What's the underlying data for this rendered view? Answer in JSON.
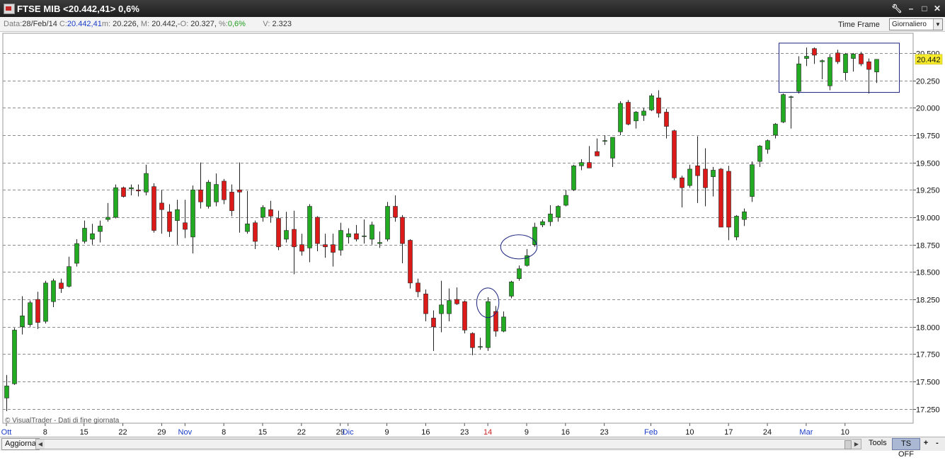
{
  "window": {
    "title": "FTSE MIB <20.442,41> 0,6%",
    "buttons": [
      "wrench-icon",
      "minimize-icon",
      "maximize-icon",
      "close-icon"
    ]
  },
  "info_bar": {
    "data_label": "Data:",
    "data_value": "28/Feb/14",
    "c_label": "C:",
    "c_value": "20.442,41",
    "m_label": "m:",
    "m_value": "20.226,",
    "M_label": "M:",
    "M_value": "20.442,",
    "o_label": "O:",
    "o_value": "20.327,",
    "pct_label": "%:",
    "pct_value": "0,6%",
    "v_label": "V:",
    "v_value": "2.323",
    "timeframe_label": "Time Frame",
    "timeframe_value": "Giornaliero"
  },
  "bottom_bar": {
    "refresh_label": "Aggiorna",
    "tools_label": "Tools",
    "tsoff_label": "TS OFF",
    "zoom_in_label": "+",
    "zoom_out_label": "-"
  },
  "chart_data": {
    "type": "candlestick",
    "watermark": "© VisualTrader - Dati di fine giornata",
    "last_price_label": "20.442",
    "y_axis": {
      "min": 17120,
      "max": 20680,
      "ticks": [
        17250,
        17500,
        17750,
        18000,
        18250,
        18500,
        18750,
        19000,
        19250,
        19500,
        19750,
        20000,
        20250,
        20500
      ],
      "tick_labels": [
        "17.250",
        "17.500",
        "17.750",
        "18.000",
        "18.250",
        "18.500",
        "18.750",
        "19.000",
        "19.250",
        "19.500",
        "19.750",
        "20.000",
        "20.250",
        "20.500"
      ],
      "grid": "dashed"
    },
    "x_axis_labels": [
      {
        "i": 0,
        "text": "Ott",
        "color": "#1a3cc8"
      },
      {
        "i": 5,
        "text": "8",
        "color": "#111111"
      },
      {
        "i": 10,
        "text": "15",
        "color": "#111111"
      },
      {
        "i": 15,
        "text": "22",
        "color": "#111111"
      },
      {
        "i": 20,
        "text": "29",
        "color": "#111111"
      },
      {
        "i": 23,
        "text": "Nov",
        "color": "#1a3cc8"
      },
      {
        "i": 28,
        "text": "8",
        "color": "#111111"
      },
      {
        "i": 33,
        "text": "15",
        "color": "#111111"
      },
      {
        "i": 38,
        "text": "22",
        "color": "#111111"
      },
      {
        "i": 43,
        "text": "29",
        "color": "#111111"
      },
      {
        "i": 44,
        "text": "Dic",
        "color": "#1a3cc8"
      },
      {
        "i": 49,
        "text": "9",
        "color": "#111111"
      },
      {
        "i": 54,
        "text": "16",
        "color": "#111111"
      },
      {
        "i": 59,
        "text": "23",
        "color": "#111111"
      },
      {
        "i": 62,
        "text": "14",
        "color": "#cc2222"
      },
      {
        "i": 67,
        "text": "9",
        "color": "#111111"
      },
      {
        "i": 72,
        "text": "16",
        "color": "#111111"
      },
      {
        "i": 77,
        "text": "23",
        "color": "#111111"
      },
      {
        "i": 83,
        "text": "Feb",
        "color": "#1a3cc8"
      },
      {
        "i": 88,
        "text": "10",
        "color": "#111111"
      },
      {
        "i": 93,
        "text": "17",
        "color": "#111111"
      },
      {
        "i": 98,
        "text": "24",
        "color": "#111111"
      },
      {
        "i": 103,
        "text": "Mar",
        "color": "#1a3cc8"
      },
      {
        "i": 108,
        "text": "10",
        "color": "#111111"
      }
    ],
    "candles": [
      {
        "o": 17350,
        "h": 17560,
        "l": 17230,
        "c": 17460
      },
      {
        "o": 17480,
        "h": 17990,
        "l": 17470,
        "c": 17970
      },
      {
        "o": 18000,
        "h": 18280,
        "l": 17930,
        "c": 18100
      },
      {
        "o": 18020,
        "h": 18240,
        "l": 18000,
        "c": 18220
      },
      {
        "o": 18250,
        "h": 18320,
        "l": 17980,
        "c": 18040
      },
      {
        "o": 18050,
        "h": 18420,
        "l": 18030,
        "c": 18400
      },
      {
        "o": 18230,
        "h": 18440,
        "l": 18180,
        "c": 18420
      },
      {
        "o": 18400,
        "h": 18440,
        "l": 18310,
        "c": 18350
      },
      {
        "o": 18370,
        "h": 18640,
        "l": 18360,
        "c": 18550
      },
      {
        "o": 18580,
        "h": 18800,
        "l": 18550,
        "c": 18760
      },
      {
        "o": 18780,
        "h": 18970,
        "l": 18760,
        "c": 18900
      },
      {
        "o": 18800,
        "h": 18940,
        "l": 18750,
        "c": 18850
      },
      {
        "o": 18870,
        "h": 18970,
        "l": 18770,
        "c": 18920
      },
      {
        "o": 18980,
        "h": 19130,
        "l": 18960,
        "c": 19000
      },
      {
        "o": 19000,
        "h": 19300,
        "l": 18990,
        "c": 19270
      },
      {
        "o": 19270,
        "h": 19280,
        "l": 19180,
        "c": 19190
      },
      {
        "o": 19260,
        "h": 19300,
        "l": 19200,
        "c": 19270
      },
      {
        "o": 19250,
        "h": 19300,
        "l": 19190,
        "c": 19240
      },
      {
        "o": 19230,
        "h": 19480,
        "l": 19200,
        "c": 19400
      },
      {
        "o": 19280,
        "h": 19310,
        "l": 18860,
        "c": 18880
      },
      {
        "o": 19130,
        "h": 19250,
        "l": 18850,
        "c": 19070
      },
      {
        "o": 19050,
        "h": 19120,
        "l": 18820,
        "c": 18870
      },
      {
        "o": 18970,
        "h": 19160,
        "l": 18750,
        "c": 19070
      },
      {
        "o": 18950,
        "h": 19160,
        "l": 18810,
        "c": 18890
      },
      {
        "o": 18820,
        "h": 19290,
        "l": 18670,
        "c": 19250
      },
      {
        "o": 19250,
        "h": 19500,
        "l": 19080,
        "c": 19140
      },
      {
        "o": 19100,
        "h": 19340,
        "l": 19080,
        "c": 19320
      },
      {
        "o": 19140,
        "h": 19400,
        "l": 19100,
        "c": 19300
      },
      {
        "o": 19330,
        "h": 19350,
        "l": 19120,
        "c": 19160
      },
      {
        "o": 19230,
        "h": 19300,
        "l": 19010,
        "c": 19060
      },
      {
        "o": 19250,
        "h": 19500,
        "l": 18860,
        "c": 19230
      },
      {
        "o": 18870,
        "h": 19240,
        "l": 18850,
        "c": 18940
      },
      {
        "o": 18950,
        "h": 18970,
        "l": 18710,
        "c": 18780
      },
      {
        "o": 19000,
        "h": 19110,
        "l": 18960,
        "c": 19090
      },
      {
        "o": 19070,
        "h": 19150,
        "l": 18950,
        "c": 19010
      },
      {
        "o": 18990,
        "h": 19060,
        "l": 18700,
        "c": 18730
      },
      {
        "o": 18800,
        "h": 19050,
        "l": 18770,
        "c": 18880
      },
      {
        "o": 18890,
        "h": 19060,
        "l": 18480,
        "c": 18730
      },
      {
        "o": 18750,
        "h": 18850,
        "l": 18650,
        "c": 18690
      },
      {
        "o": 18720,
        "h": 19120,
        "l": 18590,
        "c": 19100
      },
      {
        "o": 19000,
        "h": 19010,
        "l": 18690,
        "c": 18760
      },
      {
        "o": 18750,
        "h": 18850,
        "l": 18630,
        "c": 18730
      },
      {
        "o": 18750,
        "h": 18850,
        "l": 18550,
        "c": 18680
      },
      {
        "o": 18700,
        "h": 18950,
        "l": 18650,
        "c": 18880
      },
      {
        "o": 18820,
        "h": 18900,
        "l": 18760,
        "c": 18850
      },
      {
        "o": 18850,
        "h": 18930,
        "l": 18780,
        "c": 18800
      },
      {
        "o": 18830,
        "h": 18980,
        "l": 18760,
        "c": 18830
      },
      {
        "o": 18800,
        "h": 18960,
        "l": 18750,
        "c": 18930
      },
      {
        "o": 18760,
        "h": 18870,
        "l": 18720,
        "c": 18770
      },
      {
        "o": 18800,
        "h": 19140,
        "l": 18780,
        "c": 19100
      },
      {
        "o": 19100,
        "h": 19200,
        "l": 18960,
        "c": 19000
      },
      {
        "o": 19000,
        "h": 19020,
        "l": 18580,
        "c": 18760
      },
      {
        "o": 18790,
        "h": 18800,
        "l": 18350,
        "c": 18400
      },
      {
        "o": 18400,
        "h": 18440,
        "l": 18270,
        "c": 18320
      },
      {
        "o": 18300,
        "h": 18340,
        "l": 18050,
        "c": 18120
      },
      {
        "o": 18080,
        "h": 18150,
        "l": 17780,
        "c": 18000
      },
      {
        "o": 18120,
        "h": 18420,
        "l": 17950,
        "c": 18200
      },
      {
        "o": 18120,
        "h": 18350,
        "l": 18050,
        "c": 18240
      },
      {
        "o": 18250,
        "h": 18360,
        "l": 18200,
        "c": 18210
      },
      {
        "o": 18230,
        "h": 18240,
        "l": 17940,
        "c": 17970
      },
      {
        "o": 17940,
        "h": 17950,
        "l": 17740,
        "c": 17810
      },
      {
        "o": 17820,
        "h": 17900,
        "l": 17790,
        "c": 17820
      },
      {
        "o": 17810,
        "h": 18270,
        "l": 17780,
        "c": 18230
      },
      {
        "o": 18140,
        "h": 18190,
        "l": 17910,
        "c": 17960
      },
      {
        "o": 17960,
        "h": 18140,
        "l": 17950,
        "c": 18090
      },
      {
        "o": 18280,
        "h": 18420,
        "l": 18260,
        "c": 18410
      },
      {
        "o": 18440,
        "h": 18560,
        "l": 18420,
        "c": 18530
      },
      {
        "o": 18560,
        "h": 18710,
        "l": 18550,
        "c": 18650
      },
      {
        "o": 18750,
        "h": 18950,
        "l": 18730,
        "c": 18910
      },
      {
        "o": 18930,
        "h": 18980,
        "l": 18910,
        "c": 18960
      },
      {
        "o": 18960,
        "h": 19110,
        "l": 18920,
        "c": 19030
      },
      {
        "o": 19000,
        "h": 19110,
        "l": 18960,
        "c": 19100
      },
      {
        "o": 19110,
        "h": 19250,
        "l": 19100,
        "c": 19200
      },
      {
        "o": 19250,
        "h": 19480,
        "l": 19240,
        "c": 19470
      },
      {
        "o": 19470,
        "h": 19530,
        "l": 19430,
        "c": 19500
      },
      {
        "o": 19500,
        "h": 19650,
        "l": 19460,
        "c": 19450
      },
      {
        "o": 19600,
        "h": 19720,
        "l": 19560,
        "c": 19560
      },
      {
        "o": 19700,
        "h": 19750,
        "l": 19660,
        "c": 19700
      },
      {
        "o": 19540,
        "h": 19730,
        "l": 19460,
        "c": 19730
      },
      {
        "o": 19780,
        "h": 20060,
        "l": 19750,
        "c": 20040
      },
      {
        "o": 20050,
        "h": 20070,
        "l": 19840,
        "c": 19850
      },
      {
        "o": 19880,
        "h": 19970,
        "l": 19810,
        "c": 19960
      },
      {
        "o": 19930,
        "h": 20000,
        "l": 19880,
        "c": 19970
      },
      {
        "o": 19980,
        "h": 20130,
        "l": 19970,
        "c": 20110
      },
      {
        "o": 20090,
        "h": 20160,
        "l": 19910,
        "c": 19950
      },
      {
        "o": 19960,
        "h": 19990,
        "l": 19720,
        "c": 19830
      },
      {
        "o": 19790,
        "h": 19800,
        "l": 19340,
        "c": 19360
      },
      {
        "o": 19360,
        "h": 19380,
        "l": 19090,
        "c": 19270
      },
      {
        "o": 19290,
        "h": 19480,
        "l": 19270,
        "c": 19440
      },
      {
        "o": 19470,
        "h": 19740,
        "l": 19130,
        "c": 19380
      },
      {
        "o": 19440,
        "h": 19630,
        "l": 19100,
        "c": 19270
      },
      {
        "o": 19370,
        "h": 19460,
        "l": 19190,
        "c": 19430
      },
      {
        "o": 19440,
        "h": 19450,
        "l": 19000,
        "c": 18910
      },
      {
        "o": 19420,
        "h": 19470,
        "l": 18790,
        "c": 18910
      },
      {
        "o": 18820,
        "h": 19020,
        "l": 18790,
        "c": 19010
      },
      {
        "o": 18980,
        "h": 19080,
        "l": 18920,
        "c": 19050
      },
      {
        "o": 19190,
        "h": 19510,
        "l": 19140,
        "c": 19480
      },
      {
        "o": 19510,
        "h": 19660,
        "l": 19460,
        "c": 19650
      },
      {
        "o": 19620,
        "h": 19710,
        "l": 19580,
        "c": 19700
      },
      {
        "o": 19750,
        "h": 19860,
        "l": 19720,
        "c": 19850
      },
      {
        "o": 19870,
        "h": 20130,
        "l": 19860,
        "c": 20120
      },
      {
        "o": 20100,
        "h": 20110,
        "l": 19810,
        "c": 20100
      },
      {
        "o": 20150,
        "h": 20470,
        "l": 20130,
        "c": 20400
      },
      {
        "o": 20450,
        "h": 20550,
        "l": 20380,
        "c": 20470
      },
      {
        "o": 20540,
        "h": 20550,
        "l": 20400,
        "c": 20480
      },
      {
        "o": 20420,
        "h": 20440,
        "l": 20260,
        "c": 20430
      },
      {
        "o": 20200,
        "h": 20490,
        "l": 20160,
        "c": 20460
      },
      {
        "o": 20500,
        "h": 20530,
        "l": 20400,
        "c": 20420
      },
      {
        "o": 20320,
        "h": 20500,
        "l": 20250,
        "c": 20490
      },
      {
        "o": 20450,
        "h": 20500,
        "l": 20330,
        "c": 20490
      },
      {
        "o": 20490,
        "h": 20510,
        "l": 20380,
        "c": 20400
      },
      {
        "o": 20420,
        "h": 20450,
        "l": 20130,
        "c": 20350
      },
      {
        "o": 20327,
        "h": 20442,
        "l": 20226,
        "c": 20442
      }
    ],
    "annotations": [
      {
        "type": "ellipse",
        "around_index": 62,
        "price_center": 18220,
        "price_half_height": 135,
        "index_half_width": 1.1
      },
      {
        "type": "ellipse",
        "around_index": 66,
        "price_center": 18730,
        "price_half_height": 110,
        "index_half_width": 1.8
      },
      {
        "type": "rectangle",
        "index_from": 99.5,
        "index_to": 115,
        "price_from": 20140,
        "price_to": 20590
      }
    ],
    "colors": {
      "up": "#22aa22",
      "down": "#dd1a1a",
      "annotation": "#1a237e",
      "price_label_bg": "#f5ea2c"
    }
  }
}
